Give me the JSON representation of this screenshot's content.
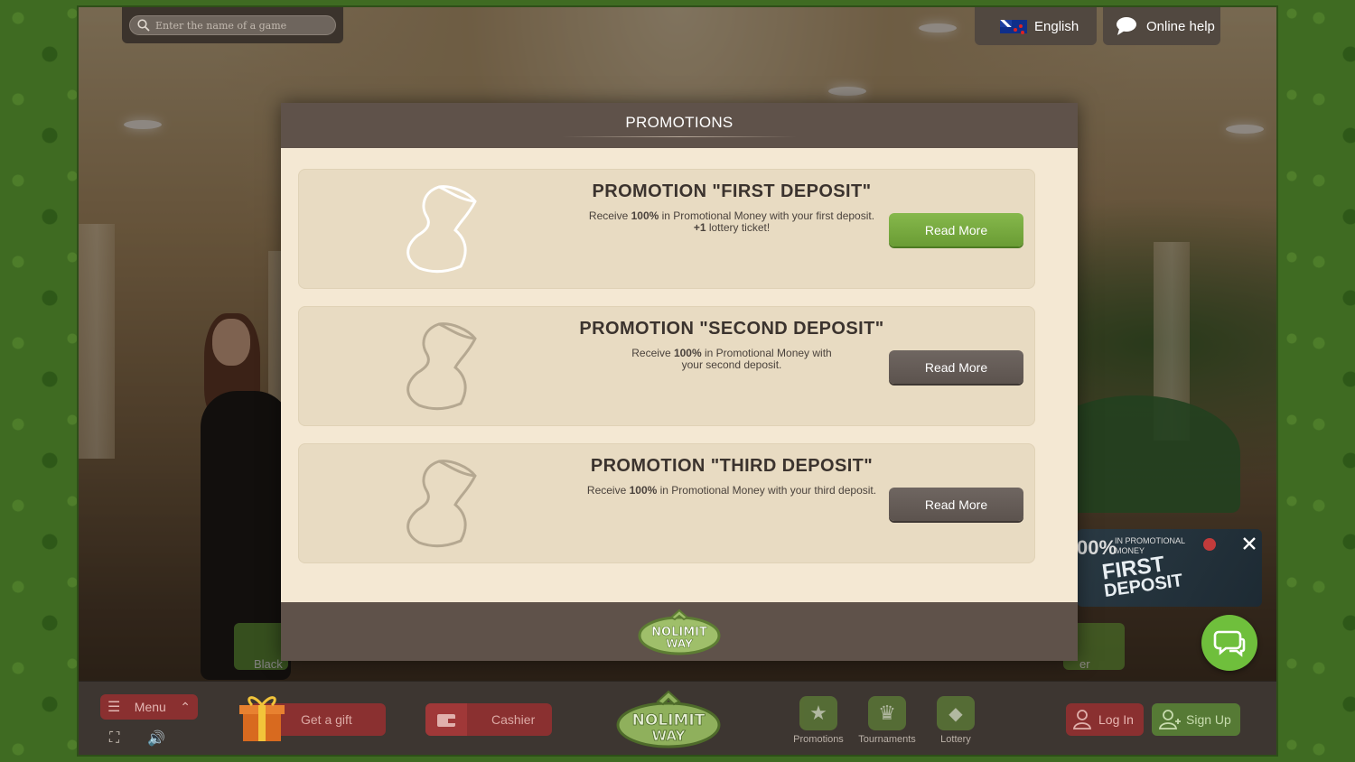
{
  "search": {
    "placeholder": "Enter the name of a game"
  },
  "header": {
    "language": "English",
    "online_help": "Online help"
  },
  "modal": {
    "title": "PROMOTIONS",
    "promotions": [
      {
        "title": "PROMOTION \"FIRST DEPOSIT\"",
        "desc_before": "Receive ",
        "desc_bold": "100%",
        "desc_after": " in Promotional Money with your first deposit.",
        "extra_bold": "+1",
        "extra_after": " lottery ticket!",
        "button": "Read More",
        "button_style": "green"
      },
      {
        "title": "PROMOTION \"SECOND DEPOSIT\"",
        "desc_before": "Receive ",
        "desc_bold": "100%",
        "desc_after": " in Promotional Money with",
        "line2": "your second deposit.",
        "button": "Read More",
        "button_style": "gray"
      },
      {
        "title": "PROMOTION \"THIRD DEPOSIT\"",
        "desc_before": "Receive ",
        "desc_bold": "100%",
        "desc_after": " in Promotional Money with your third deposit.",
        "button": "Read More",
        "button_style": "gray"
      }
    ],
    "footer_logo_line1": "NOLIMIT",
    "footer_logo_line2": "WAY"
  },
  "bottom_bar": {
    "menu": "Menu",
    "get_gift": "Get a gift",
    "cashier": "Cashier",
    "logo_line1": "NOLIMIT",
    "logo_line2": "WAY",
    "nav": [
      {
        "label": "Promotions",
        "icon": "star-icon"
      },
      {
        "label": "Tournaments",
        "icon": "trophy-icon"
      },
      {
        "label": "Lottery",
        "icon": "ticket-icon"
      }
    ],
    "login": "Log In",
    "signup": "Sign Up"
  },
  "side": {
    "left_tab": "Black",
    "right_tab": "er"
  },
  "banner": {
    "percent": "00%",
    "line1": "IN PROMOTIONAL",
    "line2": "MONEY",
    "title1": "FIRST",
    "title2": "DEPOSIT"
  },
  "colors": {
    "accent_green": "#6fbf3c",
    "modal_bg": "#f4e8d3",
    "card_bg": "#e8dbc2",
    "red_button": "#8a3030"
  }
}
